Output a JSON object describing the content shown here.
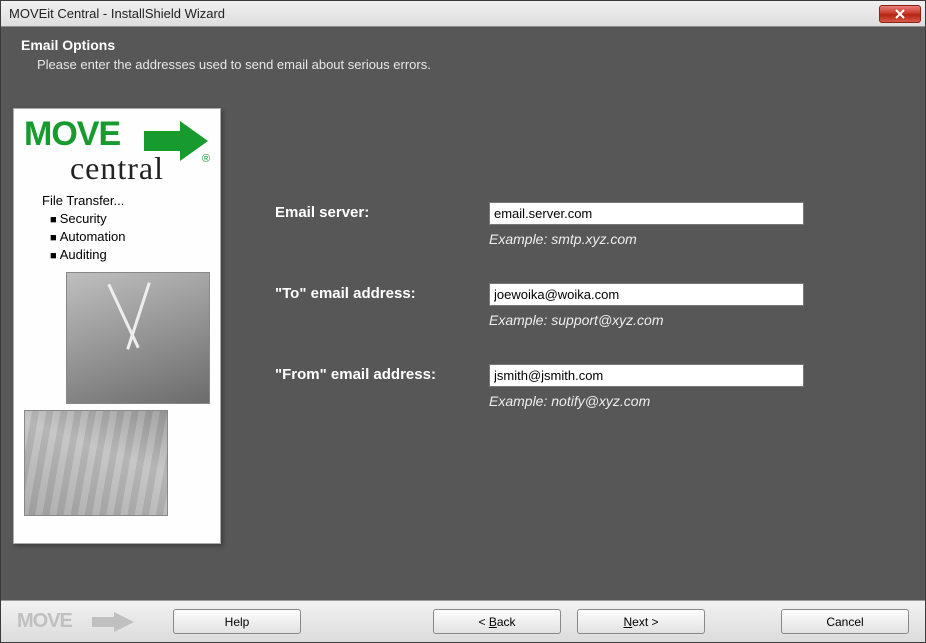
{
  "window": {
    "title": "MOVEit Central - InstallShield Wizard"
  },
  "header": {
    "title": "Email Options",
    "subtitle": "Please enter the addresses used to send email about serious errors."
  },
  "sidebar": {
    "logo_top": "MOVE",
    "logo_bottom": "central",
    "file_transfer_label": "File Transfer...",
    "items": [
      "Security",
      "Automation",
      "Auditing"
    ]
  },
  "form": {
    "email_server": {
      "label": "Email server:",
      "value": "email.server.com",
      "example": "Example: smtp.xyz.com"
    },
    "to_address": {
      "label": "\"To\" email address:",
      "value": "joewoika@woika.com",
      "example": "Example: support@xyz.com"
    },
    "from_address": {
      "label": "\"From\" email address:",
      "value": "jsmith@jsmith.com",
      "example": "Example: notify@xyz.com"
    }
  },
  "footer": {
    "logo": "MOVE",
    "help": "Help",
    "back_prefix": "< ",
    "back_u": "B",
    "back_rest": "ack",
    "next_u": "N",
    "next_rest": "ext >",
    "cancel": "Cancel"
  }
}
